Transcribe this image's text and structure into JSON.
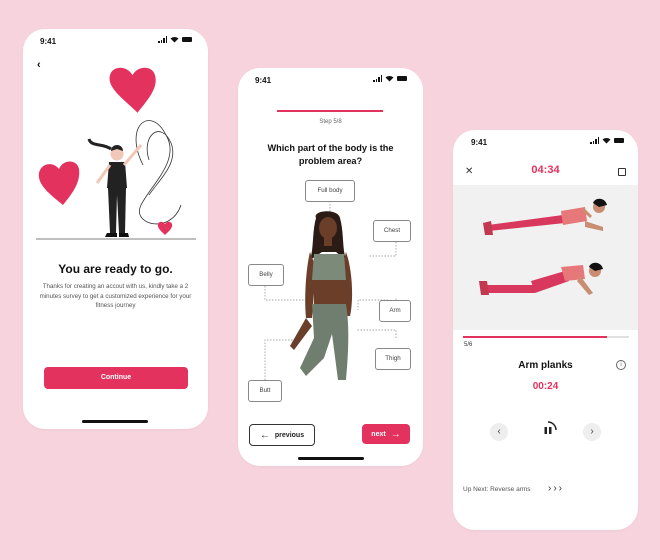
{
  "colors": {
    "background": "#f7d3dd",
    "accent": "#e4325f",
    "card": "#ffffff"
  },
  "status_bar": {
    "time": "9:41"
  },
  "welcome": {
    "back_icon": "chevron-left-icon",
    "title": "You are ready to go.",
    "description": "Thanks for creating an accout with us, kindly take a 2 minutes survey to get a customized experience for your fitness journey",
    "continue_label": "Continue"
  },
  "survey": {
    "step": "Step 5/8",
    "question": "Which part of the body is the problem area?",
    "body_parts": {
      "full_body": "Full body",
      "chest": "Chest",
      "belly": "Belly",
      "arm": "Arm",
      "thigh": "Thigh",
      "butt": "Butt"
    },
    "previous_label": "previous",
    "next_label": "next"
  },
  "workout": {
    "timer": "04:34",
    "counter": "5/6",
    "progress": 0.87,
    "exercise_title": "Arm planks",
    "exercise_time": "00:24",
    "up_next": "Up Next: Reverse arms"
  }
}
